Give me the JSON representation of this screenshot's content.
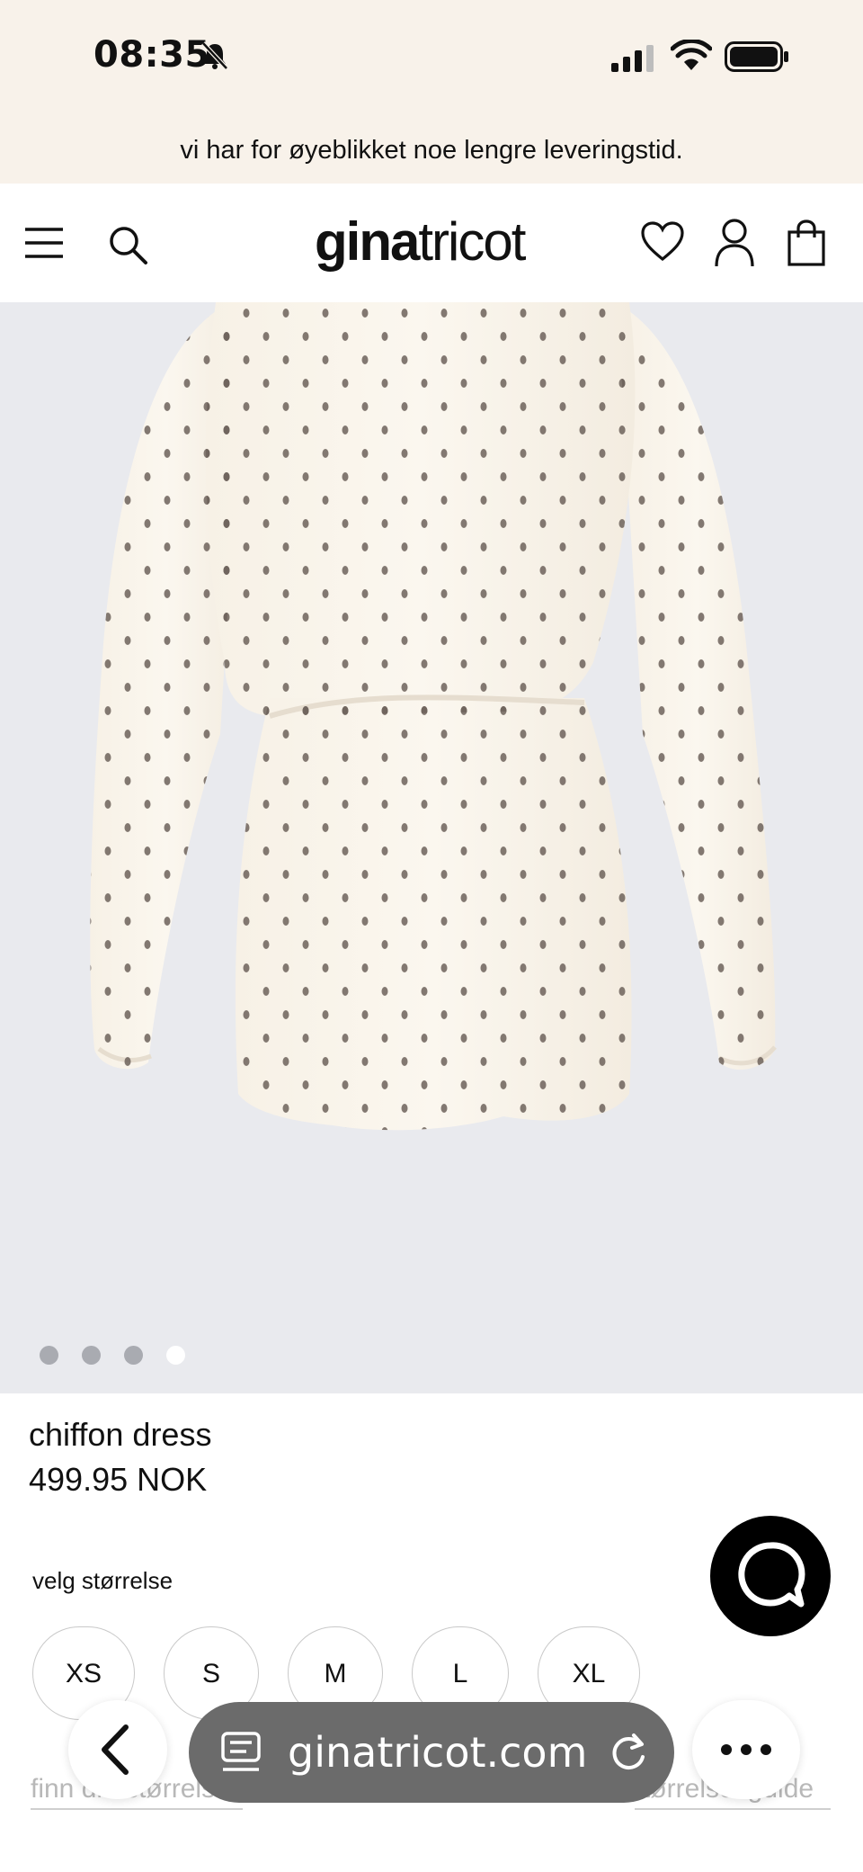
{
  "status": {
    "time": "08:35"
  },
  "banner": {
    "text": "vi har for øyeblikket noe lengre leveringstid."
  },
  "header": {
    "logo_bold": "gina",
    "logo_light": "tricot"
  },
  "gallery": {
    "slides": 4,
    "active_index": 3
  },
  "product": {
    "title": "chiffon dress",
    "price": "499.95 NOK"
  },
  "sizes": {
    "label": "velg størrelse",
    "options": [
      "XS",
      "S",
      "M",
      "L",
      "XL"
    ]
  },
  "links": {
    "find_size": "finn din størrelse",
    "size_guide": "størrelsesguide"
  },
  "browser": {
    "url": "ginatricot.com"
  },
  "icons": {
    "bell": "bell-slash-icon",
    "signal": "cellular-signal-icon",
    "wifi": "wifi-icon",
    "battery": "battery-icon",
    "menu": "hamburger-menu-icon",
    "search": "search-icon",
    "wishlist": "heart-icon",
    "account": "user-icon",
    "cart": "shopping-bag-icon",
    "chat": "chat-bubble-icon",
    "back": "chevron-left-icon",
    "reader": "reader-mode-icon",
    "reload": "reload-icon",
    "more": "more-dots-icon"
  },
  "colors": {
    "banner_bg": "#f8f2ea",
    "hero_bg": "#e9eaee",
    "chat_bg": "#000000",
    "url_bar_bg": "#6b6b6b"
  }
}
